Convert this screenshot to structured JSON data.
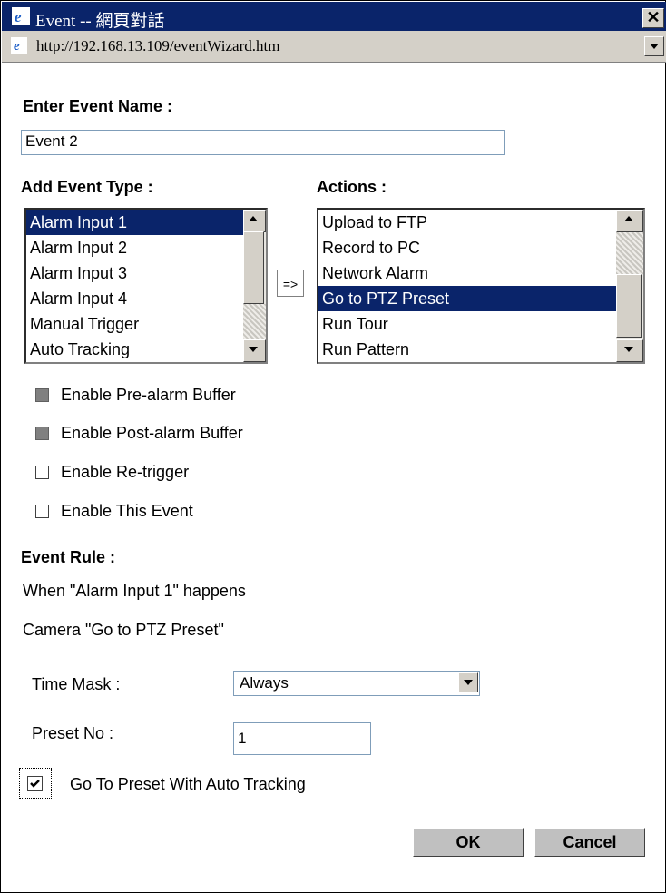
{
  "window": {
    "title": "Event -- 網頁對話",
    "close_glyph": "✕"
  },
  "address_bar": {
    "url": "http://192.168.13.109/eventWizard.htm"
  },
  "form": {
    "event_name_label": "Enter Event Name :",
    "event_name_value": "Event 2",
    "event_type_label": "Add Event Type :",
    "event_types": [
      "Alarm Input 1",
      "Alarm Input 2",
      "Alarm Input 3",
      "Alarm Input 4",
      "Manual Trigger",
      "Auto Tracking"
    ],
    "event_type_selected": "Alarm Input 1",
    "arrow_button": "=>",
    "actions_label": "Actions :",
    "actions": [
      "Upload to FTP",
      "Record to PC",
      "Network Alarm",
      "Go to PTZ Preset",
      "Run Tour",
      "Run Pattern"
    ],
    "action_selected": "Go to PTZ Preset",
    "options": [
      {
        "label": "Enable Pre-alarm Buffer",
        "state": "disabled"
      },
      {
        "label": "Enable Post-alarm Buffer",
        "state": "disabled"
      },
      {
        "label": "Enable Re-trigger",
        "state": "unchecked"
      },
      {
        "label": "Enable This Event",
        "state": "unchecked"
      }
    ],
    "event_rule_label": "Event Rule :",
    "rule_line1": "When \"Alarm Input 1\" happens",
    "rule_line2": "Camera \"Go to PTZ Preset\"",
    "time_mask_label": "Time Mask :",
    "time_mask_value": "Always",
    "preset_label": "Preset No :",
    "preset_value": "1",
    "auto_tracking_label": "Go To Preset With Auto Tracking",
    "auto_tracking_checked": true,
    "ok_label": "OK",
    "cancel_label": "Cancel"
  },
  "colors": {
    "selection": "#0a246a",
    "titlebar": "#0a246a",
    "button_face": "#c0c0c0"
  }
}
